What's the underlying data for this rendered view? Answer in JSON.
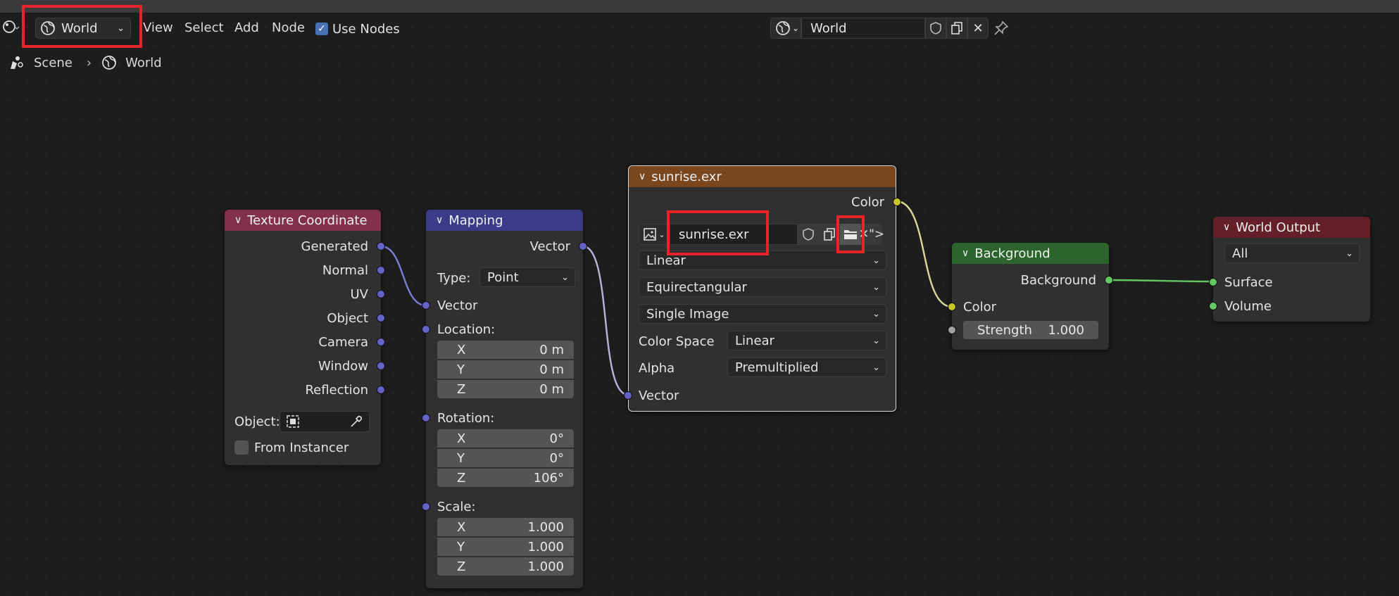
{
  "header": {
    "editor_type": "World",
    "menus": {
      "view": "View",
      "select": "Select",
      "add": "Add",
      "node": "Node"
    },
    "use_nodes_label": "Use Nodes",
    "datablock_name": "World"
  },
  "breadcrumb": {
    "scene": "Scene",
    "world": "World"
  },
  "nodes": {
    "texcoord": {
      "title": "Texture Coordinate",
      "outputs": [
        "Generated",
        "Normal",
        "UV",
        "Object",
        "Camera",
        "Window",
        "Reflection"
      ],
      "object_label": "Object:",
      "from_instancer": "From Instancer"
    },
    "mapping": {
      "title": "Mapping",
      "output": "Vector",
      "type_label": "Type:",
      "type_value": "Point",
      "vector_input": "Vector",
      "location_label": "Location:",
      "location": {
        "x": "0 m",
        "y": "0 m",
        "z": "0 m"
      },
      "rotation_label": "Rotation:",
      "rotation": {
        "x": "0°",
        "y": "0°",
        "z": "106°"
      },
      "scale_label": "Scale:",
      "scale": {
        "x": "1.000",
        "y": "1.000",
        "z": "1.000"
      },
      "axis": {
        "x": "X",
        "y": "Y",
        "z": "Z"
      }
    },
    "envtex": {
      "title": "sunrise.exr",
      "output": "Color",
      "image_name": "sunrise.exr",
      "interpolation": "Linear",
      "projection": "Equirectangular",
      "source": "Single Image",
      "color_space_label": "Color Space",
      "color_space": "Linear",
      "alpha_label": "Alpha",
      "alpha": "Premultiplied",
      "vector_input": "Vector"
    },
    "background": {
      "title": "Background",
      "output": "Background",
      "color_input": "Color",
      "strength_label": "Strength",
      "strength_value": "1.000"
    },
    "world_output": {
      "title": "World Output",
      "target": "All",
      "surface": "Surface",
      "volume": "Volume"
    }
  },
  "colors": {
    "texcoord_header": "#83314a",
    "mapping_header": "#3b3b8a",
    "envtex_header": "#79461d",
    "background_header": "#2b652b",
    "world_output_header": "#632028",
    "highlight": "#e8242a"
  },
  "icons": [
    "editor-type-icon",
    "world-icon",
    "scene-icon",
    "image-icon",
    "shield-icon",
    "duplicate-icon",
    "folder-icon",
    "close-icon",
    "pin-icon",
    "eyedropper-icon",
    "chevron-down-icon"
  ]
}
